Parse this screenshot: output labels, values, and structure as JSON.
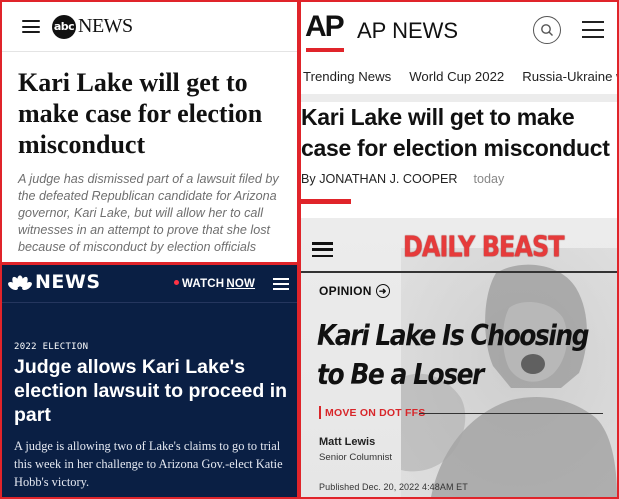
{
  "abc": {
    "logo_circle": "abc",
    "logo_word": "NEWS",
    "headline": "Kari Lake will get to make case for election misconduct",
    "dek": "A judge has dismissed part of a lawsuit filed by the defeated Republican candidate for Arizona governor, Kari Lake, but will allow her to call witnesses in an attempt to prove that she lost because of misconduct by election officials"
  },
  "ap": {
    "logo": "AP",
    "title": "AP NEWS",
    "nav": [
      "Trending News",
      "World Cup 2022",
      "Russia-Ukraine war"
    ],
    "headline": "Kari Lake will get to make case for election misconduct",
    "byline": "By JONATHAN J. COOPER",
    "time": "today"
  },
  "nbc": {
    "logo": "NEWS",
    "watch": "WATCH",
    "now": "NOW",
    "kicker": "2022 ELECTION",
    "headline": "Judge allows Kari Lake's election lawsuit to proceed in part",
    "dek": "A judge is allowing two of Lake's claims to go to trial this week in her challenge to Arizona Gov.-elect Katie Hobb's victory."
  },
  "dailybeast": {
    "logo": "DAILY BEAST",
    "section": "OPINION",
    "headline": "Kari Lake Is Choosing to Be a Loser",
    "tag": "MOVE ON DOT FFS",
    "author": "Matt Lewis",
    "role": "Senior Columnist",
    "published": "Published Dec. 20, 2022 4:48AM ET"
  },
  "colors": {
    "accent_red": "#e0242a",
    "nbc_navy": "#0a1f44",
    "daily_beast_red": "#e63b3b"
  },
  "icons": [
    "hamburger-menu-icon",
    "search-icon",
    "nbc-peacock-icon",
    "arrow-circle-right-icon"
  ]
}
